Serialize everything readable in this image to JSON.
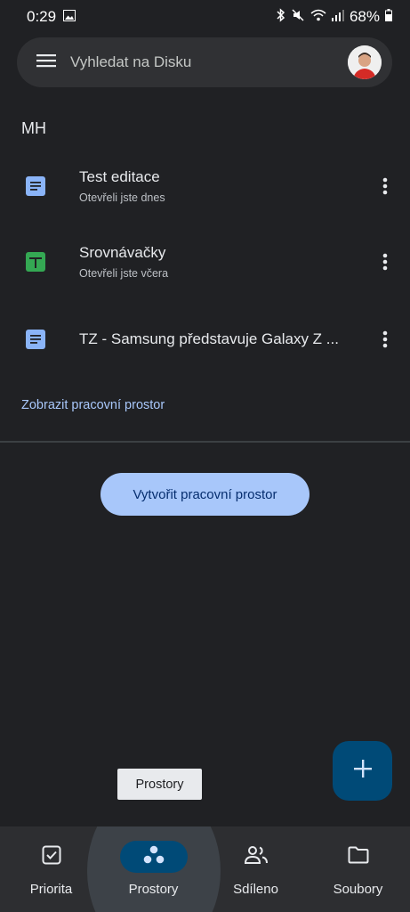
{
  "status_bar": {
    "time": "0:29",
    "battery": "68%"
  },
  "search": {
    "placeholder": "Vyhledat na Disku"
  },
  "section": {
    "title": "MH"
  },
  "files": [
    {
      "name": "Test editace",
      "subtitle": "Otevřeli jste dnes",
      "type": "docs"
    },
    {
      "name": "Srovnávačky",
      "subtitle": "Otevřeli jste včera",
      "type": "sheets"
    },
    {
      "name": "TZ - Samsung představuje Galaxy Z ...",
      "subtitle": "",
      "type": "docs"
    }
  ],
  "workspace_link": "Zobrazit pracovní prostor",
  "create_button": "Vytvořit pracovní prostor",
  "tooltip": "Prostory",
  "bottom_nav": {
    "items": [
      {
        "label": "Priorita",
        "icon": "priority-check-icon"
      },
      {
        "label": "Prostory",
        "icon": "workspaces-icon",
        "active": true
      },
      {
        "label": "Sdíleno",
        "icon": "shared-people-icon"
      },
      {
        "label": "Soubory",
        "icon": "folder-icon"
      }
    ]
  },
  "colors": {
    "background": "#202124",
    "accent": "#a8c7fa",
    "fab": "#004a77",
    "docs_blue": "#8ab4f8",
    "sheets_green": "#34a853"
  }
}
